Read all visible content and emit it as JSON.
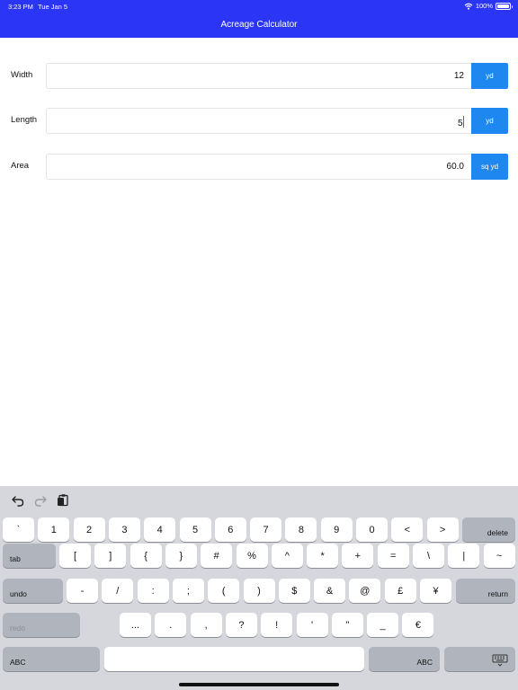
{
  "status_bar": {
    "time": "3:23 PM",
    "date": "Tue Jan 5",
    "battery": "100%"
  },
  "nav": {
    "title": "Acreage Calculator"
  },
  "rows": [
    {
      "label": "Width",
      "value": "12",
      "unit": "yd"
    },
    {
      "label": "Length",
      "value": "5",
      "unit": "yd"
    },
    {
      "label": "Area",
      "value": "60.0",
      "unit": "sq yd"
    }
  ],
  "keyboard": {
    "toolbar_icons": [
      "undo-icon",
      "redo-icon",
      "paste-icon"
    ],
    "row1": [
      "`",
      "1",
      "2",
      "3",
      "4",
      "5",
      "6",
      "7",
      "8",
      "9",
      "0",
      "<",
      ">"
    ],
    "row1_delete": "delete",
    "row2_tab": "tab",
    "row2": [
      "[",
      "]",
      "{",
      "}",
      "#",
      "%",
      "^",
      "*",
      "+",
      "=",
      "\\",
      "|",
      "~"
    ],
    "row3_undo": "undo",
    "row3": [
      "-",
      "/",
      ":",
      ";",
      "(",
      ")",
      "$",
      "&",
      "@",
      "£",
      "¥"
    ],
    "row3_return": "return",
    "row4_redo": "redo",
    "row4": [
      "...",
      ".",
      ",",
      "?",
      "!",
      "'",
      "\"",
      "_",
      "€"
    ],
    "row5_abc_left": "ABC",
    "row5_abc_right": "ABC"
  }
}
